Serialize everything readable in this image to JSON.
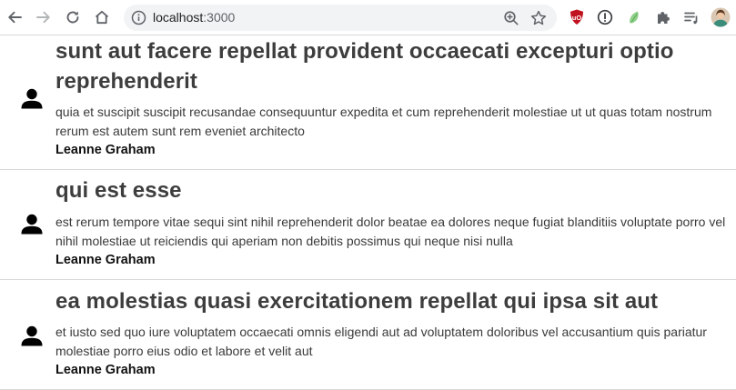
{
  "browser": {
    "url_host": "localhost",
    "url_port": ":3000",
    "icons": {
      "back": "arrow-left-icon",
      "forward": "arrow-right-icon",
      "reload": "reload-icon",
      "home": "home-icon",
      "site_info": "info-circle-icon",
      "zoom": "zoom-icon",
      "bookmark": "star-icon",
      "extensions": [
        "ublock-icon",
        "privacy-icon",
        "animal-crossing-icon",
        "puzzle-icon",
        "reading-list-icon",
        "profile-avatar-icon"
      ]
    },
    "colors": {
      "toolbar_icon": "#5f6368",
      "ublock_red": "#c1121f",
      "leaf_green": "#8fd18a"
    }
  },
  "posts": [
    {
      "title": "sunt aut facere repellat provident occaecati excepturi optio reprehenderit",
      "body": "quia et suscipit suscipit recusandae consequuntur expedita et cum reprehenderit molestiae ut ut quas totam nostrum rerum est autem sunt rem eveniet architecto",
      "author": "Leanne Graham",
      "icon": "user-icon"
    },
    {
      "title": "qui est esse",
      "body": "est rerum tempore vitae sequi sint nihil reprehenderit dolor beatae ea dolores neque fugiat blanditiis voluptate porro vel nihil molestiae ut reiciendis qui aperiam non debitis possimus qui neque nisi nulla",
      "author": "Leanne Graham",
      "icon": "user-icon"
    },
    {
      "title": "ea molestias quasi exercitationem repellat qui ipsa sit aut",
      "body": "et iusto sed quo iure voluptatem occaecati omnis eligendi aut ad voluptatem doloribus vel accusantium quis pariatur molestiae porro eius odio et labore et velit aut",
      "author": "Leanne Graham",
      "icon": "user-icon"
    }
  ]
}
